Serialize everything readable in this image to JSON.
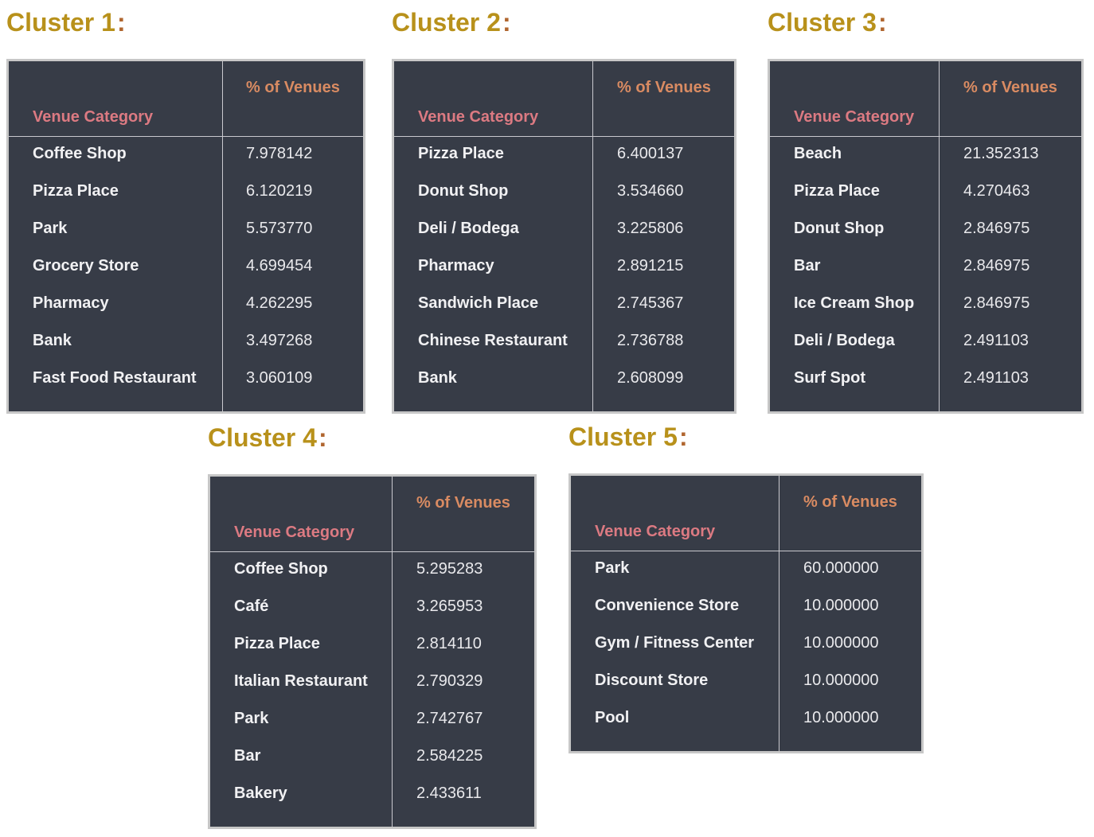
{
  "clusters": [
    {
      "title": "Cluster 1",
      "colon": ":",
      "header": {
        "venue_category": "Venue Category",
        "pct_of_venues": "% of Venues"
      },
      "rows": [
        {
          "category": "Coffee Shop",
          "pct": "7.978142"
        },
        {
          "category": "Pizza Place",
          "pct": "6.120219"
        },
        {
          "category": "Park",
          "pct": "5.573770"
        },
        {
          "category": "Grocery Store",
          "pct": "4.699454"
        },
        {
          "category": "Pharmacy",
          "pct": "4.262295"
        },
        {
          "category": "Bank",
          "pct": "3.497268"
        },
        {
          "category": "Fast Food Restaurant",
          "pct": "3.060109"
        }
      ]
    },
    {
      "title": "Cluster 2",
      "colon": ":",
      "header": {
        "venue_category": "Venue Category",
        "pct_of_venues": "% of Venues"
      },
      "rows": [
        {
          "category": "Pizza Place",
          "pct": "6.400137"
        },
        {
          "category": "Donut Shop",
          "pct": "3.534660"
        },
        {
          "category": "Deli / Bodega",
          "pct": "3.225806"
        },
        {
          "category": "Pharmacy",
          "pct": "2.891215"
        },
        {
          "category": "Sandwich Place",
          "pct": "2.745367"
        },
        {
          "category": "Chinese Restaurant",
          "pct": "2.736788"
        },
        {
          "category": "Bank",
          "pct": "2.608099"
        }
      ]
    },
    {
      "title": "Cluster 3",
      "colon": ":",
      "header": {
        "venue_category": "Venue Category",
        "pct_of_venues": "% of Venues"
      },
      "rows": [
        {
          "category": "Beach",
          "pct": "21.352313"
        },
        {
          "category": "Pizza Place",
          "pct": "4.270463"
        },
        {
          "category": "Donut Shop",
          "pct": "2.846975"
        },
        {
          "category": "Bar",
          "pct": "2.846975"
        },
        {
          "category": "Ice Cream Shop",
          "pct": "2.846975"
        },
        {
          "category": "Deli / Bodega",
          "pct": "2.491103"
        },
        {
          "category": "Surf Spot",
          "pct": "2.491103"
        }
      ]
    },
    {
      "title": "Cluster 4",
      "colon": ":",
      "header": {
        "venue_category": "Venue Category",
        "pct_of_venues": "% of Venues"
      },
      "rows": [
        {
          "category": "Coffee Shop",
          "pct": "5.295283"
        },
        {
          "category": "Café",
          "pct": "3.265953"
        },
        {
          "category": "Pizza Place",
          "pct": "2.814110"
        },
        {
          "category": "Italian Restaurant",
          "pct": "2.790329"
        },
        {
          "category": "Park",
          "pct": "2.742767"
        },
        {
          "category": "Bar",
          "pct": "2.584225"
        },
        {
          "category": "Bakery",
          "pct": "2.433611"
        }
      ]
    },
    {
      "title": "Cluster 5",
      "colon": ":",
      "header": {
        "venue_category": "Venue Category",
        "pct_of_venues": "% of Venues"
      },
      "rows": [
        {
          "category": "Park",
          "pct": "60.000000"
        },
        {
          "category": "Convenience Store",
          "pct": "10.000000"
        },
        {
          "category": "Gym / Fitness Center",
          "pct": "10.000000"
        },
        {
          "category": "Discount Store",
          "pct": "10.000000"
        },
        {
          "category": "Pool",
          "pct": "10.000000"
        }
      ]
    }
  ]
}
